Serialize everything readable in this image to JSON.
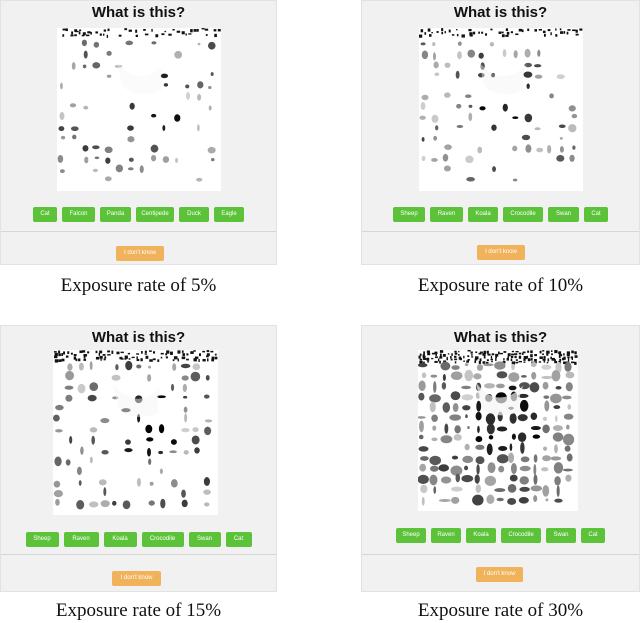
{
  "panels": [
    {
      "title": "What is this?",
      "options": [
        "Cat",
        "Falcon",
        "Panda",
        "Centipede",
        "Duck",
        "Eagle"
      ],
      "unknown_label": "I don't know",
      "caption": "Exposure rate of 5%",
      "exposure": 0.05
    },
    {
      "title": "What is this?",
      "options": [
        "Sheep",
        "Raven",
        "Koala",
        "Crocodile",
        "Swan",
        "Cat"
      ],
      "unknown_label": "I don't know",
      "caption": "Exposure rate of 10%",
      "exposure": 0.1
    },
    {
      "title": "What is this?",
      "options": [
        "Sheep",
        "Raven",
        "Koala",
        "Crocodile",
        "Swan",
        "Cat"
      ],
      "unknown_label": "I don't know",
      "caption": "Exposure rate of 15%",
      "exposure": 0.15
    },
    {
      "title": "What is this?",
      "options": [
        "Sheep",
        "Raven",
        "Koala",
        "Crocodile",
        "Swan",
        "Cat"
      ],
      "unknown_label": "I don't know",
      "caption": "Exposure rate of 30%",
      "exposure": 0.3
    }
  ],
  "colors": {
    "option_button": "#5cc23a",
    "unknown_button": "#f0b25a",
    "panel_background": "#f1f1f1"
  }
}
